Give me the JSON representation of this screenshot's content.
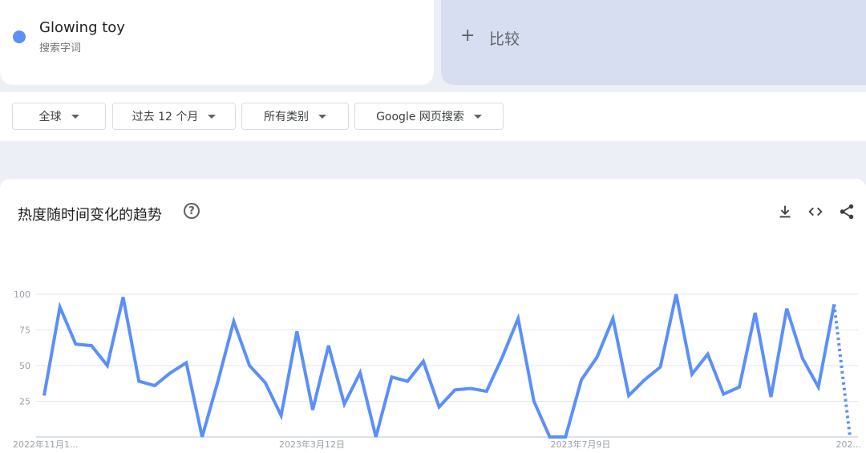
{
  "search": {
    "term": "Glowing toy",
    "term_type": "搜索字词",
    "term_color": "#5b8ff9",
    "compare_label": "比较"
  },
  "filters": {
    "region": "全球",
    "time_range": "过去 12 个月",
    "category": "所有类别",
    "search_type": "Google 网页搜索"
  },
  "chart_header": {
    "title": "热度随时间变化的趋势",
    "help": "?"
  },
  "chart_data": {
    "type": "line",
    "title": "热度随时间变化的趋势",
    "xlabel": "",
    "ylabel": "",
    "ylim": [
      0,
      100
    ],
    "yticks": [
      25,
      50,
      75,
      100
    ],
    "x_tick_labels": [
      "2022年11月1...",
      "2023年3月12日",
      "2023年7月9日",
      "202..."
    ],
    "grid": true,
    "legend": "none",
    "series": [
      {
        "color": "#5b8ff9",
        "values": [
          29,
          91,
          65,
          64,
          50,
          98,
          39,
          36,
          45,
          52,
          0,
          39,
          81,
          50,
          38,
          15,
          74,
          19,
          64,
          23,
          45,
          0,
          42,
          39,
          53,
          21,
          33,
          34,
          32,
          56,
          83,
          25,
          0,
          0,
          40,
          56,
          83,
          29,
          40,
          49,
          100,
          44,
          58,
          30,
          35,
          87,
          28,
          90,
          55,
          35,
          93
        ],
        "partial_tail": [
          93,
          0
        ]
      }
    ]
  }
}
